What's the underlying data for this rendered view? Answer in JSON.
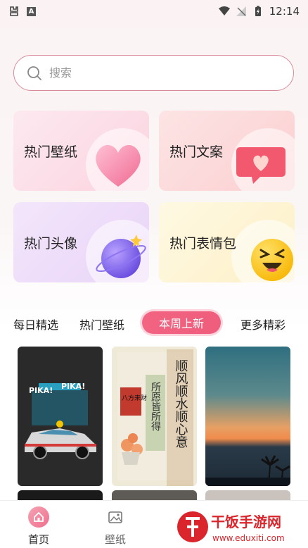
{
  "status_bar": {
    "time": "12:14",
    "notification_letter": "A"
  },
  "search": {
    "placeholder": "搜索"
  },
  "categories": [
    {
      "label": "热门壁纸"
    },
    {
      "label": "热门文案"
    },
    {
      "label": "热门头像"
    },
    {
      "label": "热门表情包"
    }
  ],
  "tabs": [
    {
      "label": "每日精选"
    },
    {
      "label": "热门壁纸"
    },
    {
      "label": "本周上新",
      "active": true
    },
    {
      "label": "更多精彩"
    }
  ],
  "wallpapers": {
    "w1_text": [
      "PIKA!",
      "PIKA!"
    ],
    "w2_title": "顺风顺水顺心意",
    "w2_sub": "所愿皆所得",
    "w2_stamp": "八方来财"
  },
  "bottom_nav": [
    {
      "label": "首页",
      "active": true
    },
    {
      "label": "壁纸"
    }
  ],
  "watermark": {
    "brand": "干饭手游网",
    "url": "www.eduxiti.com"
  },
  "colors": {
    "accent": "#ef5d7c",
    "search_border": "#d98a9a"
  }
}
